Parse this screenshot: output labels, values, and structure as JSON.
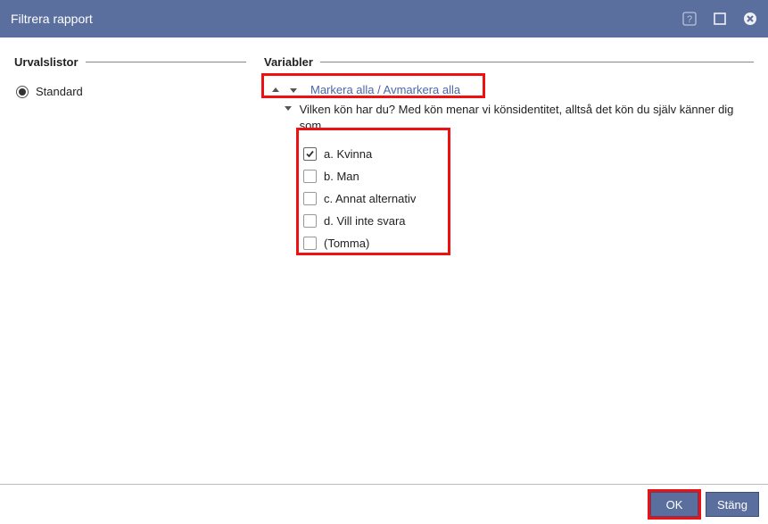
{
  "title": "Filtrera rapport",
  "sections": {
    "left_legend": "Urvalslistor",
    "right_legend": "Variabler"
  },
  "selection_list": {
    "standard_label": "Standard"
  },
  "variables": {
    "toggle_all_label": "Markera alla / Avmarkera alla",
    "question": "Vilken kön har du? Med kön menar vi könsidentitet, alltså det kön du själv känner dig som.",
    "options": [
      {
        "label": "a. Kvinna",
        "checked": true
      },
      {
        "label": "b. Man",
        "checked": false
      },
      {
        "label": "c. Annat alternativ",
        "checked": false
      },
      {
        "label": "d. Vill inte svara",
        "checked": false
      },
      {
        "label": "(Tomma)",
        "checked": false
      }
    ]
  },
  "footer": {
    "ok_label": "OK",
    "close_label": "Stäng"
  }
}
